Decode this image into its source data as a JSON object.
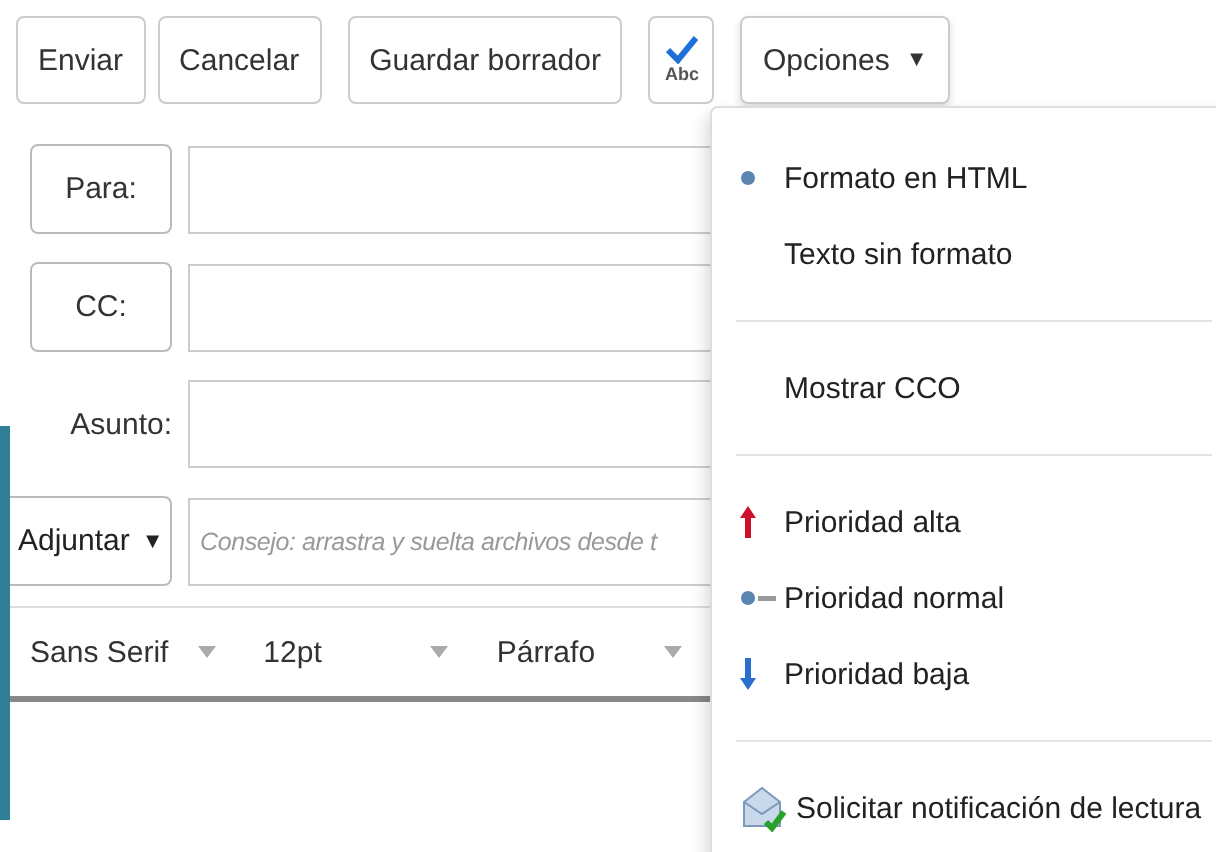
{
  "toolbar": {
    "buttons": [
      {
        "label": "Enviar"
      },
      {
        "label": "Cancelar"
      },
      {
        "label": "Guardar borrador"
      }
    ],
    "spellcheck_label": "Abc",
    "options": {
      "label": "Opciones",
      "caret": "▼",
      "expanded": true
    }
  },
  "form": {
    "recipients": [
      {
        "label": "Para:"
      },
      {
        "label": "CC:"
      }
    ],
    "subject": {
      "label": "Asunto:"
    },
    "attach": {
      "label": "Adjuntar",
      "caret": "▼",
      "placeholder": "Consejo: arrastra y suelta archivos desde t"
    }
  },
  "format_bar": [
    {
      "value": "Sans Serif"
    },
    {
      "value": "12pt"
    },
    {
      "value": "Párrafo"
    }
  ],
  "menu": [
    [
      {
        "kind": "radio",
        "label": "Formato en HTML",
        "selected": true
      },
      {
        "kind": "radio",
        "label": "Texto sin formato",
        "selected": false
      }
    ],
    [
      {
        "kind": "plain",
        "label": "Mostrar CCO"
      }
    ],
    [
      {
        "kind": "priority-high",
        "label": "Prioridad alta",
        "selected": false
      },
      {
        "kind": "priority-normal",
        "label": "Prioridad normal",
        "selected": true
      },
      {
        "kind": "priority-low",
        "label": "Prioridad baja",
        "selected": false
      }
    ],
    [
      {
        "kind": "receipt",
        "label": "Solicitar notificación de lectura"
      }
    ]
  ]
}
